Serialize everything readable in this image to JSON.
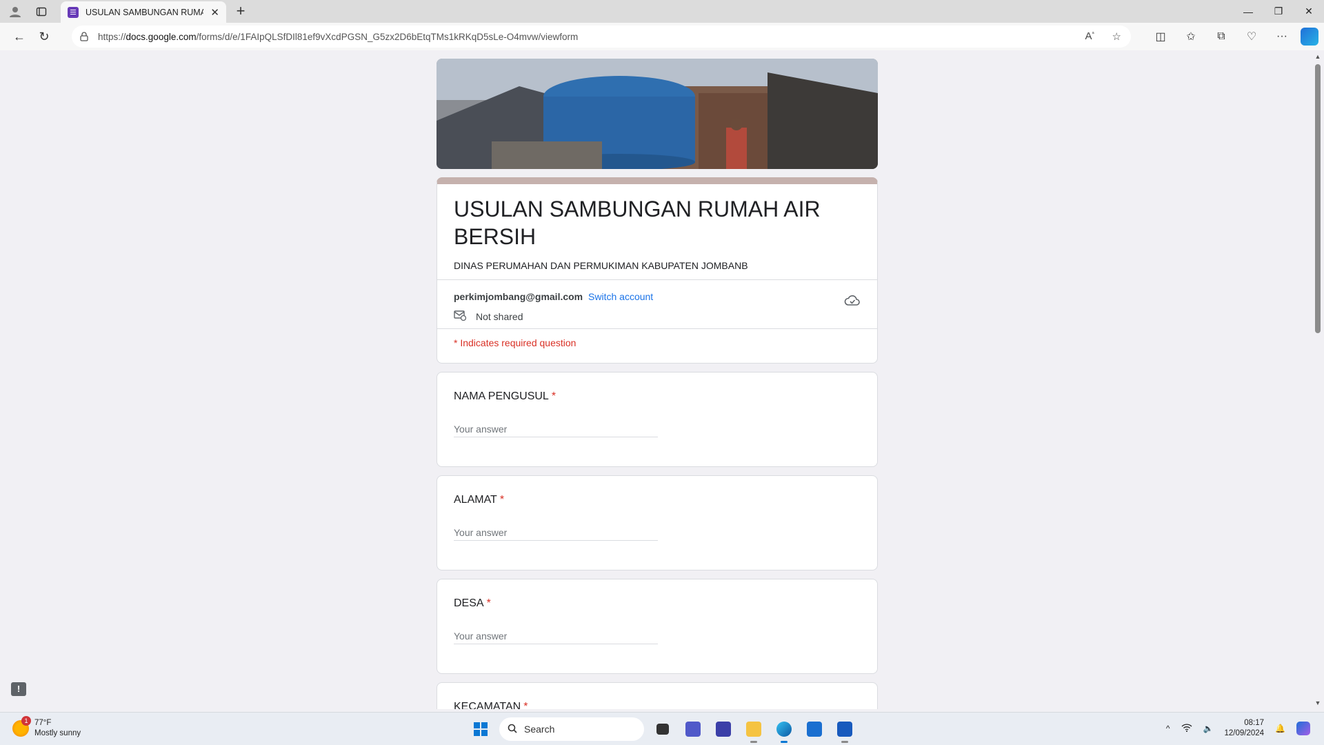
{
  "browser": {
    "tab_title": "USULAN SAMBUNGAN RUMAH AIR BERSIH",
    "url_prefix": "https://",
    "url_host": "docs.google.com",
    "url_path": "/forms/d/e/1FAIpQLSfDIl81ef9vXcdPGSN_G5zx2D6bEtqTMs1kRKqD5sLe-O4mvw/viewform"
  },
  "form": {
    "title": "USULAN SAMBUNGAN RUMAH AIR BERSIH",
    "description": "DINAS PERUMAHAN DAN PERMUKIMAN KABUPATEN JOMBANB",
    "account_email": "perkimjombang@gmail.com",
    "switch_account_label": "Switch account",
    "not_shared_label": "Not shared",
    "required_note": "* Indicates required question",
    "answer_placeholder": "Your answer",
    "questions": [
      {
        "label": "NAMA PENGUSUL",
        "required_mark": "*"
      },
      {
        "label": "ALAMAT",
        "required_mark": "*"
      },
      {
        "label": "DESA",
        "required_mark": "*"
      },
      {
        "label": "KECAMATAN",
        "required_mark": "*"
      }
    ]
  },
  "taskbar": {
    "weather_badge": "1",
    "temperature": "77°F",
    "condition": "Mostly sunny",
    "search_label": "Search",
    "time": "08:17",
    "date": "12/09/2024"
  },
  "colors": {
    "theme_accent": "#c5b1ad",
    "required_red": "#d93025",
    "link_blue": "#1a73e8"
  }
}
